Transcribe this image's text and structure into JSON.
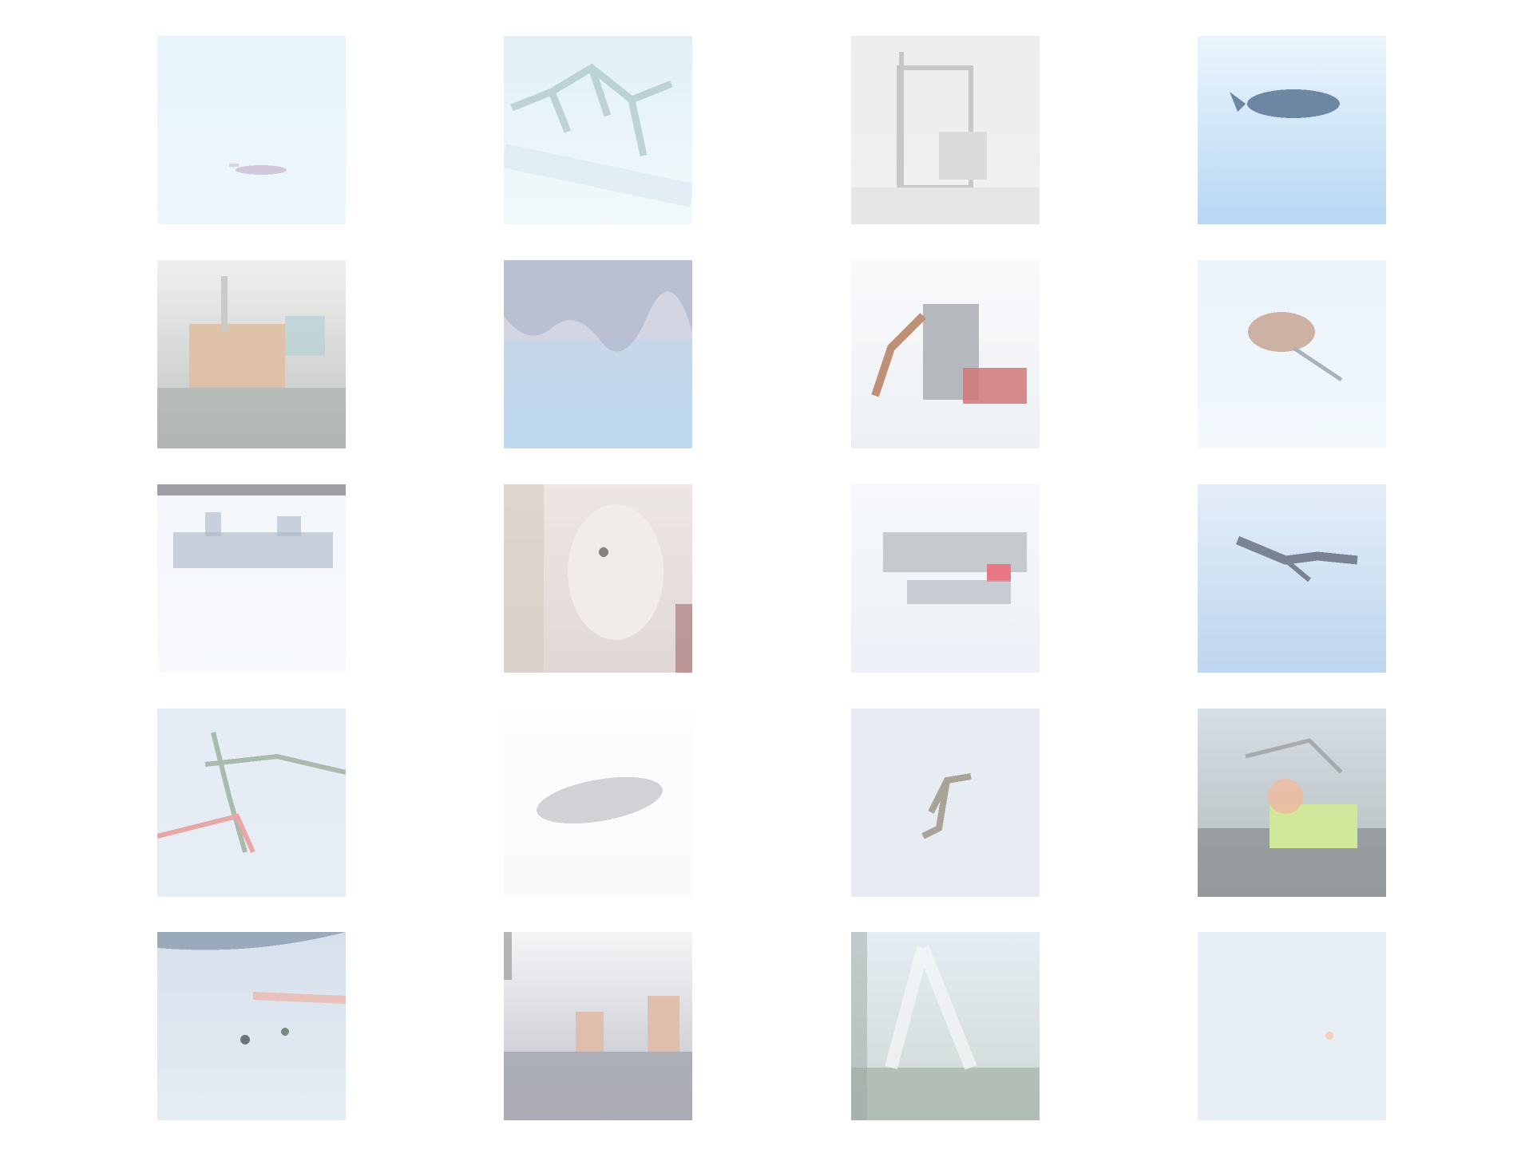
{
  "grid": {
    "rows": 5,
    "cols": 4,
    "background": "#ffffff"
  },
  "tiles": [
    {
      "name": "tile-small-aircraft-in-pale-sky",
      "bg": [
        "#dff2fb",
        "#e6f3fa"
      ],
      "accent": "#b9a8c4",
      "shape": "small-plane"
    },
    {
      "name": "tile-blue-sky-with-branches",
      "bg": [
        "#d6ebf3",
        "#eef7fb"
      ],
      "accent": "#8fb2b5",
      "shape": "branches"
    },
    {
      "name": "tile-grey-structure",
      "bg": [
        "#e7e7e7",
        "#ececec"
      ],
      "accent": "#b4b4b4",
      "shape": "structure"
    },
    {
      "name": "tile-dark-aircraft-blue-sky",
      "bg": [
        "#e4f2fb",
        "#9fcaf0"
      ],
      "accent": "#3d5f84",
      "shape": "dark-plane"
    },
    {
      "name": "tile-orange-vehicle-scene",
      "bg": [
        "#e9eceb",
        "#a9aea9"
      ],
      "accent": "#d6a87f",
      "shape": "vehicle"
    },
    {
      "name": "tile-treeline-over-blue",
      "bg": [
        "#bcc7d6",
        "#a9cdee"
      ],
      "accent": "#8e98b2",
      "shape": "treeline"
    },
    {
      "name": "tile-grey-machine-red-boat",
      "bg": [
        "#f7f8fa",
        "#e6ebf1"
      ],
      "accent": "#c24a4a",
      "shape": "machine"
    },
    {
      "name": "tile-brown-bird-in-sky",
      "bg": [
        "#e4f0fa",
        "#eef6fb"
      ],
      "accent": "#b78f79",
      "shape": "bird"
    },
    {
      "name": "tile-ship-on-pale-water",
      "bg": [
        "#eef3f9",
        "#f6f8fc"
      ],
      "accent": "#8f9fb3",
      "shape": "ship"
    },
    {
      "name": "tile-animal-face-closeup",
      "bg": [
        "#e7ded9",
        "#d6cbc6"
      ],
      "accent": "#a49895",
      "shape": "animal"
    },
    {
      "name": "tile-ship-with-red-detail",
      "bg": [
        "#f4f6fa",
        "#e4ecf3"
      ],
      "accent": "#e04a5a",
      "shape": "redship"
    },
    {
      "name": "tile-dark-plane-blue-sky",
      "bg": [
        "#dbe8f6",
        "#a8c8ea"
      ],
      "accent": "#4e5a6e",
      "shape": "plane-blue"
    },
    {
      "name": "tile-leaping-figure",
      "bg": [
        "#dce6f2",
        "#dfe7f1"
      ],
      "accent": "#e08a8a",
      "shape": "figure"
    },
    {
      "name": "tile-grey-blimp",
      "bg": [
        "#fbfcfe",
        "#f7f9fb"
      ],
      "accent": "#b9bcc2",
      "shape": "blimp"
    },
    {
      "name": "tile-small-bird-grey-sky",
      "bg": [
        "#dfe6ee",
        "#dfe6ee"
      ],
      "accent": "#8d8474",
      "shape": "small-bird"
    },
    {
      "name": "tile-green-yellow-vehicle",
      "bg": [
        "#c9d4de",
        "#9aa3a4"
      ],
      "accent": "#c2df7a",
      "shape": "green-vehicle"
    },
    {
      "name": "tile-beach-with-figures",
      "bg": [
        "#c9d6e6",
        "#dde6f0"
      ],
      "accent": "#e79a86",
      "shape": "beach"
    },
    {
      "name": "tile-buildings-over-road",
      "bg": [
        "#f1f2f5",
        "#a7a9b4"
      ],
      "accent": "#d6a58c",
      "shape": "buildings"
    },
    {
      "name": "tile-trees-misty-sky",
      "bg": [
        "#dce7ef",
        "#c0c9c6"
      ],
      "accent": "#7a917f",
      "shape": "trees"
    },
    {
      "name": "tile-faint-orange-speck",
      "bg": [
        "#e0e9f4",
        "#dfe8f2"
      ],
      "accent": "#f1c2a0",
      "shape": "speck"
    }
  ]
}
